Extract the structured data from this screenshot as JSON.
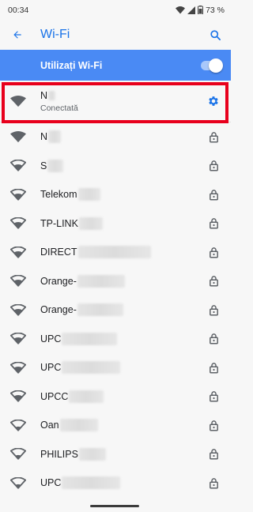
{
  "status_bar": {
    "time": "00:34",
    "battery": "73 %"
  },
  "app_bar": {
    "title": "Wi-Fi",
    "back_icon": "arrow-back-icon",
    "search_icon": "search-icon"
  },
  "master_toggle": {
    "label": "Utilizați Wi-Fi",
    "enabled": true
  },
  "connected_network": {
    "ssid_visible": "N",
    "status": "Conectată",
    "signal": "full",
    "settings_icon": "gear-icon"
  },
  "networks": [
    {
      "ssid_visible": "N",
      "secured": true,
      "signal": "full"
    },
    {
      "ssid_visible": "S",
      "secured": true,
      "signal": "medium"
    },
    {
      "ssid_visible": "Telekom",
      "secured": true,
      "signal": "medium"
    },
    {
      "ssid_visible": "TP-LINK",
      "secured": true,
      "signal": "medium"
    },
    {
      "ssid_visible": "DIRECT",
      "secured": true,
      "signal": "medium"
    },
    {
      "ssid_visible": "Orange-",
      "secured": true,
      "signal": "medium"
    },
    {
      "ssid_visible": "Orange-",
      "secured": true,
      "signal": "medium"
    },
    {
      "ssid_visible": "UPC",
      "secured": true,
      "signal": "medium"
    },
    {
      "ssid_visible": "UPC",
      "secured": true,
      "signal": "medium"
    },
    {
      "ssid_visible": "UPCC",
      "secured": true,
      "signal": "medium"
    },
    {
      "ssid_visible": "Oan",
      "secured": true,
      "signal": "low"
    },
    {
      "ssid_visible": "PHILIPS",
      "secured": false,
      "signal": "low"
    },
    {
      "ssid_visible": "UPC",
      "secured": true,
      "signal": "low"
    }
  ],
  "colors": {
    "accent": "#1a73e8",
    "toggle_bar": "#4a8af4",
    "highlight": "#e8001c",
    "icon": "#5f6368"
  }
}
